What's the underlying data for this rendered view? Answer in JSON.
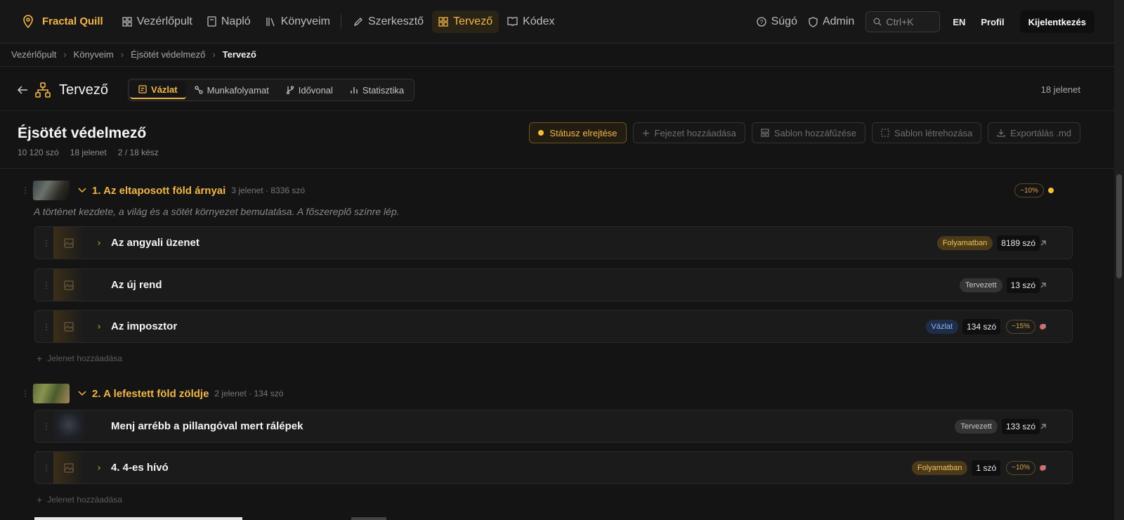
{
  "topbar": {
    "brand": "Fractal Quill",
    "nav": [
      {
        "label": "Vezérlőpult",
        "icon": "dashboard-icon"
      },
      {
        "label": "Napló",
        "icon": "journal-icon"
      },
      {
        "label": "Könyveim",
        "icon": "library-icon"
      },
      {
        "label": "Szerkesztő",
        "icon": "pencil-icon"
      },
      {
        "label": "Tervező",
        "icon": "grid-icon"
      },
      {
        "label": "Kódex",
        "icon": "book-icon"
      }
    ],
    "help": "Súgó",
    "admin": "Admin",
    "search_shortcut": "Ctrl+K",
    "lang": "EN",
    "profile": "Profil",
    "logout": "Kijelentkezés"
  },
  "breadcrumb": [
    "Vezérlőpult",
    "Könyveim",
    "Éjsötét védelmező",
    "Tervező"
  ],
  "page": {
    "title": "Tervező",
    "tabs": [
      "Vázlat",
      "Munkafolyamat",
      "Idővonal",
      "Statisztika"
    ],
    "scene_count": "18 jelenet"
  },
  "book": {
    "title": "Éjsötét védelmező",
    "stats": [
      "10 120 szó",
      "18 jelenet",
      "2 / 18 kész"
    ],
    "actions": [
      "Státusz elrejtése",
      "Fejezet hozzáadása",
      "Sablon hozzáfűzése",
      "Sablon létrehozása",
      "Exportálás .md"
    ]
  },
  "chapters": [
    {
      "title": "1. Az eltaposott föld árnyai",
      "meta": "3 jelenet · 8336 szó",
      "progress": "~10%",
      "status_color": "#f2c037",
      "description": "A történet kezdete, a világ és a sötét környezet bemutatása. A főszereplő színre lép.",
      "scenes": [
        {
          "title": "Az angyali üzenet",
          "status": "Folyamatban",
          "words": "8189 szó"
        },
        {
          "title": "Az új rend",
          "status": "Tervezett",
          "words": "13 szó"
        },
        {
          "title": "Az imposztor",
          "status": "Vázlat",
          "words": "134 szó",
          "progress": "~15%"
        }
      ],
      "add_scene": "Jelenet hozzáadása"
    },
    {
      "title": "2. A lefestett föld zöldje",
      "meta": "2 jelenet · 134 szó",
      "scenes": [
        {
          "title": "Menj arrébb a pillangóval mert rálépek",
          "status": "Tervezett",
          "words": "133 szó"
        },
        {
          "title": "4. 4-es hívó",
          "status": "Folyamatban",
          "words": "1 szó",
          "progress": "~10%"
        }
      ],
      "add_scene": "Jelenet hozzáadása"
    }
  ],
  "colors": {
    "accent": "#f2b64a",
    "red_dot": "#e35d5d"
  }
}
